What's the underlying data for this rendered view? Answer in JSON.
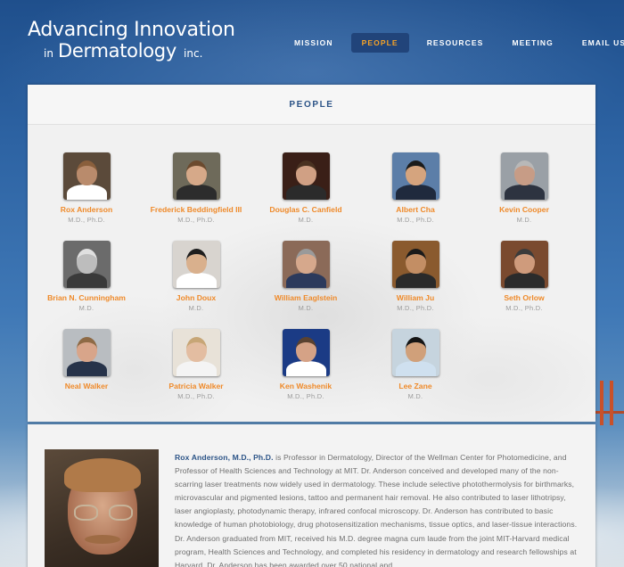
{
  "logo": {
    "line1": "Advancing Innovation",
    "line2_prefix": "in",
    "line2_main": "Dermatology",
    "line2_suffix": "inc."
  },
  "nav": [
    {
      "label": "MISSION",
      "active": false
    },
    {
      "label": "PEOPLE",
      "active": true
    },
    {
      "label": "RESOURCES",
      "active": false
    },
    {
      "label": "MEETING",
      "active": false
    },
    {
      "label": "EMAIL US",
      "active": false
    }
  ],
  "panel": {
    "title": "PEOPLE"
  },
  "people": [
    {
      "name": "Rox Anderson",
      "degree": "M.D., Ph.D.",
      "skin": "#b98b6c",
      "shirt": "#ffffff",
      "bg": "#5b4a3a",
      "hair": "#8a5f3c"
    },
    {
      "name": "Frederick Beddingfield III",
      "degree": "M.D., Ph.D.",
      "skin": "#d6a989",
      "shirt": "#2c2c2c",
      "bg": "#6e6a5a",
      "hair": "#6b4a2e"
    },
    {
      "name": "Douglas C. Canfield",
      "degree": "M.D.",
      "skin": "#d0a084",
      "shirt": "#2b2b2b",
      "bg": "#3a1f17",
      "hair": "#4a3221"
    },
    {
      "name": "Albert Cha",
      "degree": "M.D., Ph.D.",
      "skin": "#d5a47e",
      "shirt": "#1f2a3d",
      "bg": "#5c7ea8",
      "hair": "#1b1b1b"
    },
    {
      "name": "Kevin Cooper",
      "degree": "M.D.",
      "skin": "#c79c86",
      "shirt": "#2d3340",
      "bg": "#9aa0a6",
      "hair": "#b8b8b8"
    },
    {
      "name": "Brian N. Cunningham",
      "degree": "M.D.",
      "skin": "#bdbdbd",
      "shirt": "#3a3a3a",
      "bg": "#6b6b6b",
      "hair": "#e0e0e0"
    },
    {
      "name": "John Doux",
      "degree": "M.D.",
      "skin": "#d9b08d",
      "shirt": "#ffffff",
      "bg": "#d8d4cf",
      "hair": "#1e1e1e"
    },
    {
      "name": "William Eaglstein",
      "degree": "M.D.",
      "skin": "#d6a88c",
      "shirt": "#2c3a5c",
      "bg": "#8b6a58",
      "hair": "#9a9a9a"
    },
    {
      "name": "William Ju",
      "degree": "M.D., Ph.D.",
      "skin": "#c38e64",
      "shirt": "#2a2a2a",
      "bg": "#8a5a2e",
      "hair": "#1a1a1a"
    },
    {
      "name": "Seth Orlow",
      "degree": "M.D., Ph.D.",
      "skin": "#cf9b7c",
      "shirt": "#2b2b2b",
      "bg": "#7a4a2f",
      "hair": "#3b3b3b"
    },
    {
      "name": "Neal Walker",
      "degree": "",
      "skin": "#d8a58a",
      "shirt": "#27334a",
      "bg": "#b9bdc1",
      "hair": "#8e6a45"
    },
    {
      "name": "Patricia Walker",
      "degree": "M.D., Ph.D.",
      "skin": "#e3bda1",
      "shirt": "#f4f4f4",
      "bg": "#e8e2d8",
      "hair": "#c7a676"
    },
    {
      "name": "Ken Washenik",
      "degree": "M.D., Ph.D.",
      "skin": "#d5a286",
      "shirt": "#ffffff",
      "bg": "#1b3b85",
      "hair": "#5a4230"
    },
    {
      "name": "Lee Zane",
      "degree": "M.D.",
      "skin": "#d0a07a",
      "shirt": "#cfe0ef",
      "bg": "#c6d4de",
      "hair": "#151515"
    }
  ],
  "detail": {
    "lead": "Rox Anderson, M.D., Ph.D.",
    "body": " is Professor in Dermatology, Director of the Wellman Center for Photomedicine, and Professor of Health Sciences and Technology at MIT. Dr. Anderson conceived and developed many of the non-scarring laser treatments now widely used in dermatology. These include selective photothermolysis for birthmarks, microvascular and pigmented lesions, tattoo and permanent hair removal. He also contributed to laser lithotripsy, laser angioplasty, photodynamic therapy, infrared confocal microscopy. Dr. Anderson has contributed to basic knowledge of human photobiology, drug photosensitization mechanisms, tissue optics, and laser-tissue interactions. Dr. Anderson graduated from MIT, received his M.D. degree magna cum laude from the joint MIT-Harvard medical program, Health Sciences and Technology, and completed his residency in dermatology and research fellowships at Harvard. Dr. Anderson has been awarded over 50 national and"
  }
}
